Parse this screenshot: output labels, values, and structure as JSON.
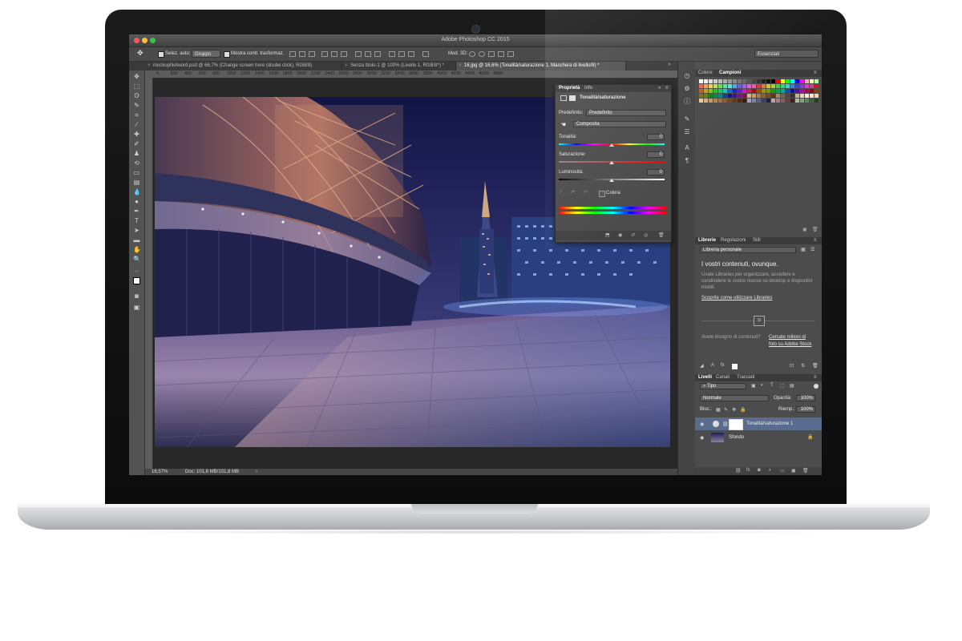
{
  "window": {
    "title": "Adobe Photoshop CC 2015"
  },
  "options_bar": {
    "auto_select_label": "Selez. auto:",
    "auto_select_value": "Gruppo",
    "transform_label": "Mostra contr. trasformaz.",
    "mode_3d_label": "Mod. 3D:",
    "workspace": "Essenziali"
  },
  "tabs": [
    {
      "label": "mockupNetword.psd @ 66,7% (Change screen here (doube click), RGB/8)"
    },
    {
      "label": "Senza titolo-1 @ 100% (Livello 1, RGB/8*) *"
    },
    {
      "label": "16.jpg @ 16,6% (Tonalità/saturazione 1, Maschera di livello/8) *"
    }
  ],
  "ruler_ticks": [
    "0",
    "200",
    "400",
    "600",
    "800",
    "1000",
    "1200",
    "1400",
    "1600",
    "1800",
    "2000",
    "2200",
    "2400",
    "2600",
    "2800",
    "3000",
    "3200",
    "3400",
    "3600",
    "3800",
    "4000",
    "4200",
    "4400",
    "4600",
    "4800"
  ],
  "status": {
    "zoom": "16,57%",
    "doc": "Doc: 101,8 MB/101,8 MB"
  },
  "properties": {
    "tab_properties": "Proprietà",
    "tab_info": "Info",
    "adjustment_title": "Tonalità/saturazione",
    "preset_label": "Predefinito:",
    "preset_value": "Predefinito",
    "channel_value": "Composita",
    "hue_label": "Tonalità:",
    "hue_value": "0",
    "saturation_label": "Saturazione:",
    "saturation_value": "0",
    "lightness_label": "Luminosità:",
    "lightness_value": "0",
    "colorize_label": "Colora"
  },
  "swatches_panel": {
    "tab_color": "Colore",
    "tab_swatches": "Campioni",
    "colors": [
      "#ffffff",
      "#eeeeee",
      "#dddddd",
      "#cccccc",
      "#bbbbbb",
      "#aaaaaa",
      "#999999",
      "#888888",
      "#777777",
      "#666666",
      "#555555",
      "#444444",
      "#333333",
      "#222222",
      "#111111",
      "#000000",
      "#ff0000",
      "#ffff00",
      "#00ff00",
      "#00ffff",
      "#0000ff",
      "#ff00ff",
      "#ffaaaa",
      "#ffffaa",
      "#aaffaa",
      "#f06060",
      "#f0a060",
      "#f0d060",
      "#c0e060",
      "#60e060",
      "#60e0a0",
      "#60e0e0",
      "#60a0e0",
      "#6060e0",
      "#a060e0",
      "#e060e0",
      "#e060a0",
      "#d04040",
      "#d08040",
      "#d0c040",
      "#a0d040",
      "#40d040",
      "#40d080",
      "#40d0d0",
      "#4080d0",
      "#4040d0",
      "#8040d0",
      "#d040d0",
      "#d04080",
      "#c02020",
      "#c06020",
      "#c0a020",
      "#80c020",
      "#20c020",
      "#20c060",
      "#20c0c0",
      "#2060c0",
      "#2020c0",
      "#6020c0",
      "#c020c0",
      "#c02060",
      "#a01010",
      "#a05010",
      "#a09010",
      "#70a010",
      "#10a010",
      "#10a050",
      "#10a0a0",
      "#1050a0",
      "#1010a0",
      "#5010a0",
      "#a010a0",
      "#a01050",
      "#801010",
      "#804010",
      "#807010",
      "#608010",
      "#108010",
      "#108040",
      "#108080",
      "#104080",
      "#101080",
      "#401080",
      "#801080",
      "#801040",
      "#d9b38c",
      "#c69c6d",
      "#a67c52",
      "#8c6239",
      "#754c24",
      "#603913",
      "#998675",
      "#736357",
      "#534741",
      "#362f2d",
      "#c7b299",
      "#e6d5c3",
      "#f5ecdf",
      "#ffe4c4",
      "#f0d9b5",
      "#e8c9a0",
      "#d6b083",
      "#c49a6c",
      "#b08558",
      "#9c7045",
      "#885c34",
      "#744a25",
      "#603a18",
      "#4c2b0d",
      "#382006",
      "#a0a0c0",
      "#8080a0",
      "#606080",
      "#404060",
      "#202040",
      "#c0a0a0",
      "#a08080",
      "#806060",
      "#604040",
      "#402020",
      "#a0c0a0",
      "#80a080",
      "#608060",
      "#406040",
      "#204020"
    ]
  },
  "libraries": {
    "tab_libraries": "Librerie",
    "tab_adjustments": "Regolazioni",
    "tab_styles": "Stili",
    "library_select": "Libreria personale",
    "heading": "I vostri contenuti, ovunque.",
    "body": "Usate Libraries per organizzare, accedere e condividere le vostre risorse su desktop e dispositivi mobili.",
    "learn_link": "Scoprite come utilizzare Libraries",
    "stock_text": "Avete bisogno di contenuti?",
    "stock_link": "Cercate milioni di foto su Adobe Stock"
  },
  "layers_panel": {
    "tab_layers": "Livelli",
    "tab_channels": "Canali",
    "tab_paths": "Tracciati",
    "filter": "Tipo",
    "blend_mode": "Normale",
    "opacity_label": "Opacità:",
    "opacity_value": "100%",
    "lock_label": "Bloc.:",
    "fill_label": "Riemp.:",
    "fill_value": "100%",
    "layers": [
      {
        "name": "Tonalità/saturazione 1"
      },
      {
        "name": "Sfondo"
      }
    ]
  },
  "colors": {
    "traffic_red": "#fc5753",
    "traffic_yellow": "#fdbc40",
    "traffic_green": "#33c748",
    "selected_layer": "#5a6c8e"
  }
}
